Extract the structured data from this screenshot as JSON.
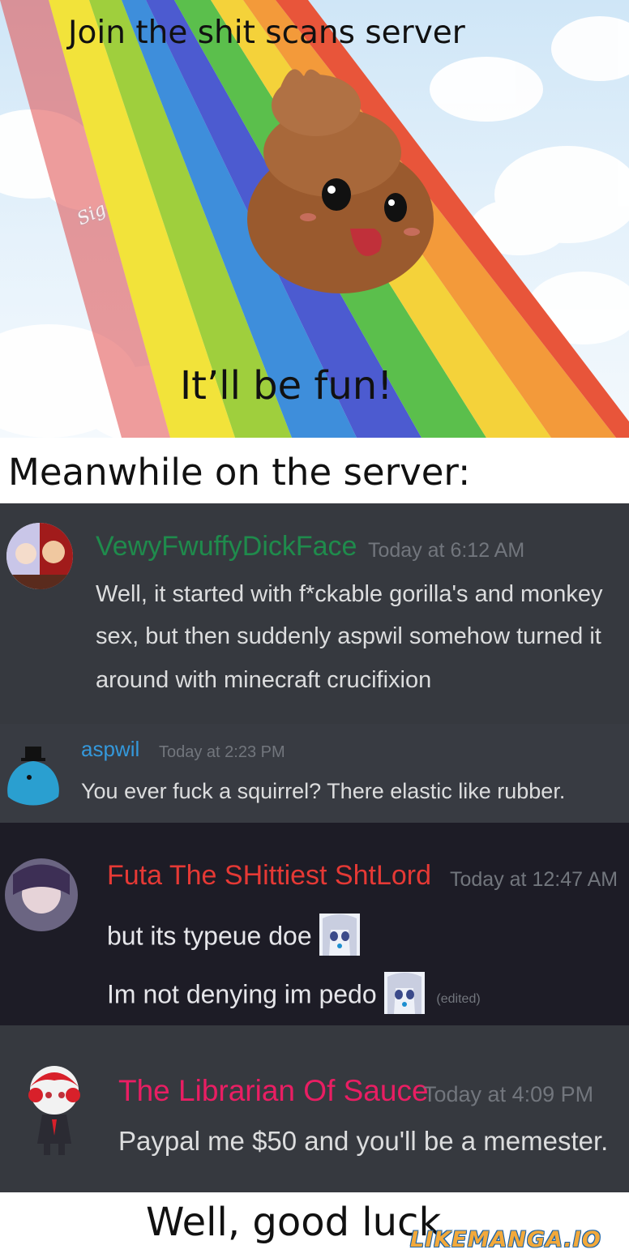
{
  "top_panel": {
    "caption_top": "Join the shit scans server",
    "caption_middle": "It’ll be fun!"
  },
  "meanwhile_caption": "Meanwhile on the server:",
  "messages": [
    {
      "username": "VewyFwuffyDickFace",
      "timestamp": "Today at 6:12 AM",
      "username_color": "#1f8b4c",
      "lines": [
        "Well, it started with f*ckable gorilla's and monkey",
        "sex, but then suddenly aspwil somehow turned it",
        "around with minecraft crucifixion"
      ]
    },
    {
      "username": "aspwil",
      "timestamp": "Today at 2:23 PM",
      "username_color": "#3498db",
      "lines": [
        "You ever fuck a squirrel? There elastic like rubber."
      ]
    },
    {
      "username": "Futa The SHittiest ShtLord",
      "timestamp": "Today at 12:47 AM",
      "username_color": "#e53935",
      "lines": [
        "but its typeue doe",
        "Im not denying im pedo"
      ],
      "edited_label": "(edited)"
    },
    {
      "username": "The Librarian Of Sauce",
      "timestamp": "Today at 4:09 PM",
      "username_color": "#e91e63",
      "lines": [
        "Paypal me $50 and you'll be a memester."
      ]
    }
  ],
  "footer_caption": "Well, good luck",
  "watermark": "LIKEMANGA.IO",
  "colors": {
    "chat_background": "#36393f",
    "message_text": "#dcddde",
    "timestamp": "#72767d"
  }
}
